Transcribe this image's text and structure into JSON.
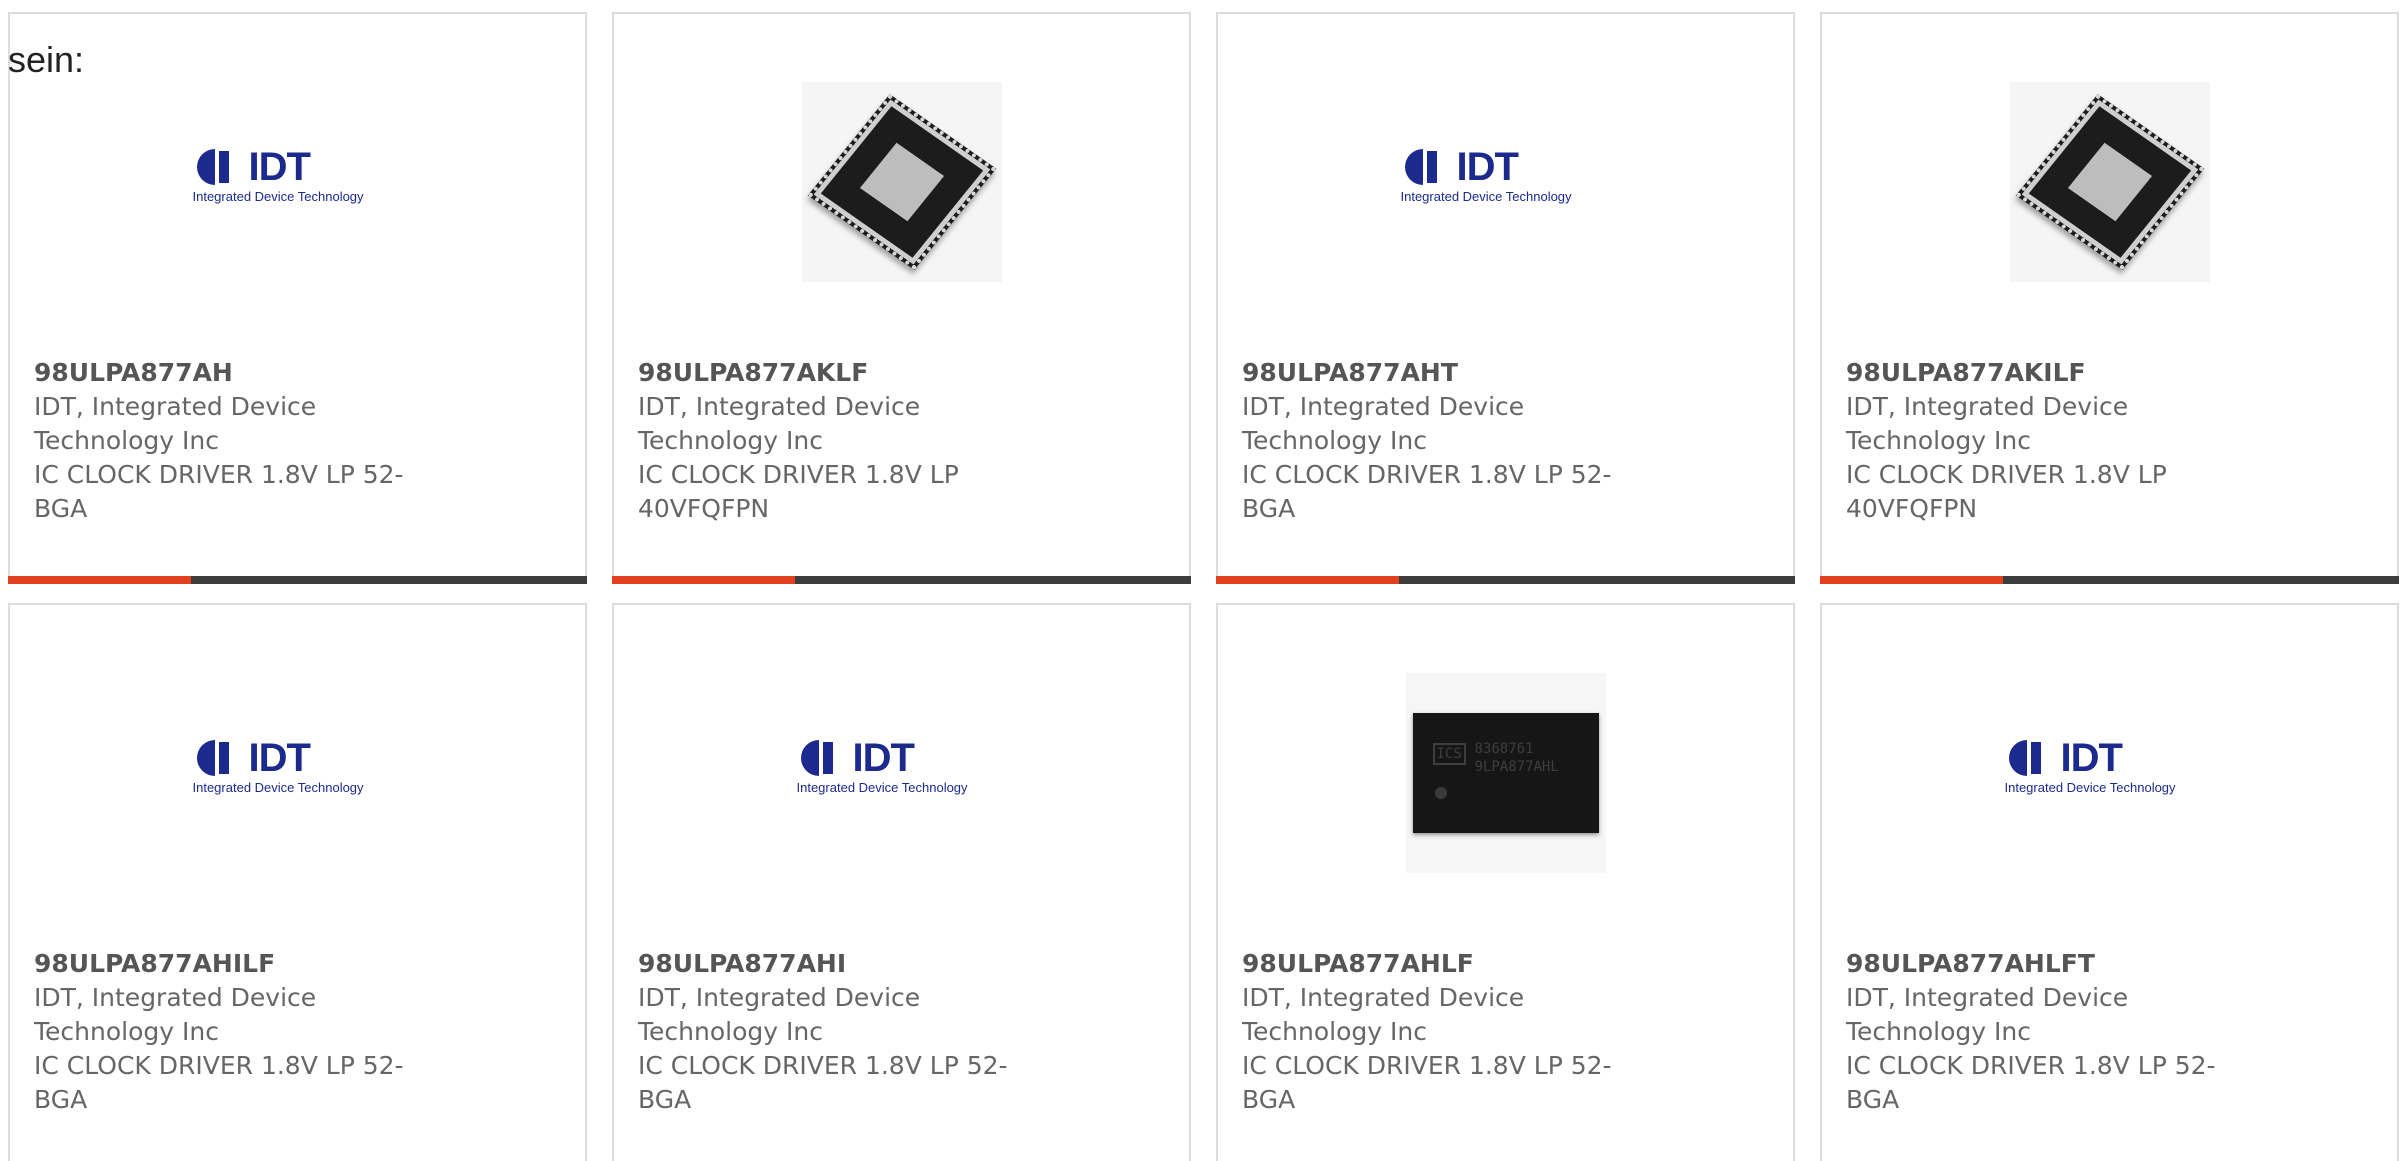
{
  "intro_text": "sein:",
  "colors": {
    "accent": "#e0401e",
    "bar": "#3d3d3d",
    "text": "#666666"
  },
  "logo": {
    "brand": "IDT",
    "tagline": "Integrated Device Technology"
  },
  "chip_photo": {
    "marking_brand": "ICS",
    "marking_line1": "8368761",
    "marking_line2": "9LPA877AHL"
  },
  "products": [
    {
      "part": "98ULPA877AH",
      "maker_line1": "IDT, Integrated Device",
      "maker_line2": "Technology Inc",
      "desc_line1": "IC CLOCK DRIVER 1.8V LP 52-",
      "desc_line2": "BGA",
      "image": "idt-logo"
    },
    {
      "part": "98ULPA877AKLF",
      "maker_line1": "IDT, Integrated Device",
      "maker_line2": "Technology Inc",
      "desc_line1": "IC CLOCK DRIVER 1.8V LP",
      "desc_line2": "40VFQFPN",
      "image": "qfn-chip"
    },
    {
      "part": "98ULPA877AHT",
      "maker_line1": "IDT, Integrated Device",
      "maker_line2": "Technology Inc",
      "desc_line1": "IC CLOCK DRIVER 1.8V LP 52-",
      "desc_line2": "BGA",
      "image": "idt-logo"
    },
    {
      "part": "98ULPA877AKILF",
      "maker_line1": "IDT, Integrated Device",
      "maker_line2": "Technology Inc",
      "desc_line1": "IC CLOCK DRIVER 1.8V LP",
      "desc_line2": "40VFQFPN",
      "image": "qfn-chip"
    },
    {
      "part": "98ULPA877AHILF",
      "maker_line1": "IDT, Integrated Device",
      "maker_line2": "Technology Inc",
      "desc_line1": "IC CLOCK DRIVER 1.8V LP 52-",
      "desc_line2": "BGA",
      "image": "idt-logo"
    },
    {
      "part": "98ULPA877AHI",
      "maker_line1": "IDT, Integrated Device",
      "maker_line2": "Technology Inc",
      "desc_line1": "IC CLOCK DRIVER 1.8V LP 52-",
      "desc_line2": "BGA",
      "image": "idt-logo"
    },
    {
      "part": "98ULPA877AHLF",
      "maker_line1": "IDT, Integrated Device",
      "maker_line2": "Technology Inc",
      "desc_line1": "IC CLOCK DRIVER 1.8V LP 52-",
      "desc_line2": "BGA",
      "image": "bga-chip"
    },
    {
      "part": "98ULPA877AHLFT",
      "maker_line1": "IDT, Integrated Device",
      "maker_line2": "Technology Inc",
      "desc_line1": "IC CLOCK DRIVER 1.8V LP 52-",
      "desc_line2": "BGA",
      "image": "idt-logo"
    }
  ]
}
